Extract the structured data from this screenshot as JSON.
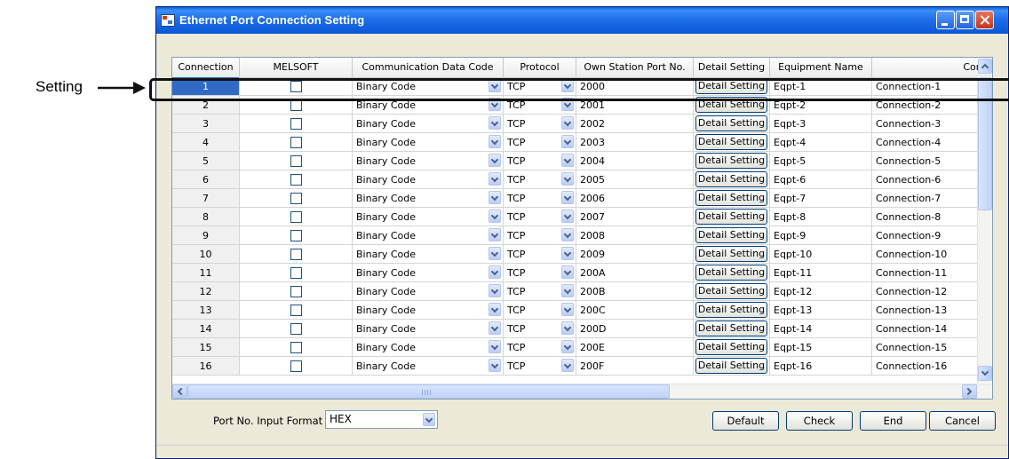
{
  "callout": {
    "label": "Setting"
  },
  "window": {
    "title": "Ethernet Port Connection Setting"
  },
  "columns": [
    "Connection",
    "MELSOFT",
    "Communication Data Code",
    "Protocol",
    "Own Station Port No.",
    "Detail Setting",
    "Equipment Name",
    "Comr"
  ],
  "rows": [
    {
      "conn": "1",
      "data_code": "Binary Code",
      "protocol": "TCP",
      "port": "2000",
      "detail": "Detail Setting",
      "equipment": "Eqpt-1",
      "comment": "Connection-1"
    },
    {
      "conn": "2",
      "data_code": "Binary Code",
      "protocol": "TCP",
      "port": "2001",
      "detail": "Detail Setting",
      "equipment": "Eqpt-2",
      "comment": "Connection-2"
    },
    {
      "conn": "3",
      "data_code": "Binary Code",
      "protocol": "TCP",
      "port": "2002",
      "detail": "Detail Setting",
      "equipment": "Eqpt-3",
      "comment": "Connection-3"
    },
    {
      "conn": "4",
      "data_code": "Binary Code",
      "protocol": "TCP",
      "port": "2003",
      "detail": "Detail Setting",
      "equipment": "Eqpt-4",
      "comment": "Connection-4"
    },
    {
      "conn": "5",
      "data_code": "Binary Code",
      "protocol": "TCP",
      "port": "2004",
      "detail": "Detail Setting",
      "equipment": "Eqpt-5",
      "comment": "Connection-5"
    },
    {
      "conn": "6",
      "data_code": "Binary Code",
      "protocol": "TCP",
      "port": "2005",
      "detail": "Detail Setting",
      "equipment": "Eqpt-6",
      "comment": "Connection-6"
    },
    {
      "conn": "7",
      "data_code": "Binary Code",
      "protocol": "TCP",
      "port": "2006",
      "detail": "Detail Setting",
      "equipment": "Eqpt-7",
      "comment": "Connection-7"
    },
    {
      "conn": "8",
      "data_code": "Binary Code",
      "protocol": "TCP",
      "port": "2007",
      "detail": "Detail Setting",
      "equipment": "Eqpt-8",
      "comment": "Connection-8"
    },
    {
      "conn": "9",
      "data_code": "Binary Code",
      "protocol": "TCP",
      "port": "2008",
      "detail": "Detail Setting",
      "equipment": "Eqpt-9",
      "comment": "Connection-9"
    },
    {
      "conn": "10",
      "data_code": "Binary Code",
      "protocol": "TCP",
      "port": "2009",
      "detail": "Detail Setting",
      "equipment": "Eqpt-10",
      "comment": "Connection-10"
    },
    {
      "conn": "11",
      "data_code": "Binary Code",
      "protocol": "TCP",
      "port": "200A",
      "detail": "Detail Setting",
      "equipment": "Eqpt-11",
      "comment": "Connection-11"
    },
    {
      "conn": "12",
      "data_code": "Binary Code",
      "protocol": "TCP",
      "port": "200B",
      "detail": "Detail Setting",
      "equipment": "Eqpt-12",
      "comment": "Connection-12"
    },
    {
      "conn": "13",
      "data_code": "Binary Code",
      "protocol": "TCP",
      "port": "200C",
      "detail": "Detail Setting",
      "equipment": "Eqpt-13",
      "comment": "Connection-13"
    },
    {
      "conn": "14",
      "data_code": "Binary Code",
      "protocol": "TCP",
      "port": "200D",
      "detail": "Detail Setting",
      "equipment": "Eqpt-14",
      "comment": "Connection-14"
    },
    {
      "conn": "15",
      "data_code": "Binary Code",
      "protocol": "TCP",
      "port": "200E",
      "detail": "Detail Setting",
      "equipment": "Eqpt-15",
      "comment": "Connection-15"
    },
    {
      "conn": "16",
      "data_code": "Binary Code",
      "protocol": "TCP",
      "port": "200F",
      "detail": "Detail Setting",
      "equipment": "Eqpt-16",
      "comment": "Connection-16"
    }
  ],
  "footer": {
    "port_format_label": "Port No. Input Format",
    "port_format_value": "HEX",
    "default_label": "Default",
    "check_label": "Check",
    "end_label": "End",
    "cancel_label": "Cancel"
  },
  "colors": {
    "titlebar": "#0b56d6",
    "selected_row": "#316ac5",
    "window_bg": "#ece9d8"
  }
}
